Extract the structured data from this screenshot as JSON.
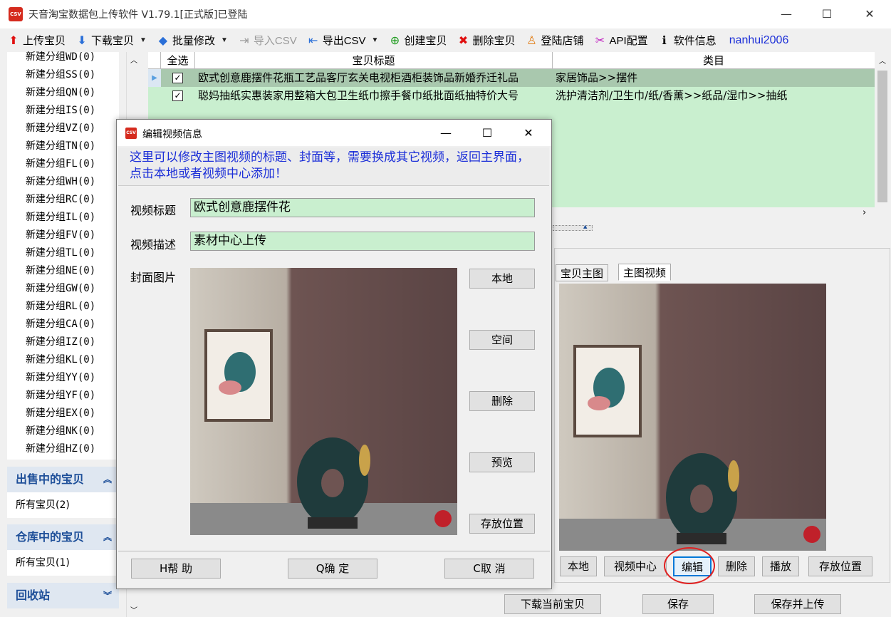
{
  "app": {
    "title": "天音淘宝数据包上传软件 V1.79.1[正式版]已登陆",
    "icon_text": "CSV",
    "minimize": "—",
    "maximize": "☐",
    "close": "✕"
  },
  "toolbar": {
    "upload": "上传宝贝",
    "download": "下载宝贝",
    "batch_edit": "批量修改",
    "import_csv": "导入CSV",
    "export_csv": "导出CSV",
    "create": "创建宝贝",
    "delete": "删除宝贝",
    "login_store": "登陆店铺",
    "api_config": "API配置",
    "software_info": "软件信息",
    "user": "nanhui2006"
  },
  "sidebar": {
    "groups": [
      "新建分组WD(0)",
      "新建分组SS(0)",
      "新建分组QN(0)",
      "新建分组IS(0)",
      "新建分组VZ(0)",
      "新建分组TN(0)",
      "新建分组FL(0)",
      "新建分组WH(0)",
      "新建分组RC(0)",
      "新建分组IL(0)",
      "新建分组FV(0)",
      "新建分组TL(0)",
      "新建分组NE(0)",
      "新建分组GW(0)",
      "新建分组RL(0)",
      "新建分组CA(0)",
      "新建分组IZ(0)",
      "新建分组KL(0)",
      "新建分组YY(0)",
      "新建分组YF(0)",
      "新建分组EX(0)",
      "新建分组NK(0)",
      "新建分组HZ(0)"
    ],
    "on_sale_title": "出售中的宝贝",
    "on_sale_item": "所有宝贝(2)",
    "warehouse_title": "仓库中的宝贝",
    "warehouse_item": "所有宝贝(1)",
    "recycle_title": "回收站"
  },
  "grid": {
    "headers": {
      "select_all": "全选",
      "title": "宝贝标题",
      "category": "类目"
    },
    "rows": [
      {
        "checked": "✓",
        "title": "欧式创意鹿摆件花瓶工艺品客厅玄关电视柜酒柜装饰品新婚乔迁礼品",
        "category": "家居饰品>>摆件"
      },
      {
        "checked": "✓",
        "title": "聪妈抽纸实惠装家用整箱大包卫生纸巾擦手餐巾纸批面纸抽特价大号",
        "category": "洗护清洁剂/卫生巾/纸/香薰>>纸品/湿巾>>抽纸"
      }
    ]
  },
  "right_panel": {
    "tab_main_image": "宝贝主图",
    "tab_main_video": "主图视频",
    "btn_local": "本地",
    "btn_video_center": "视频中心",
    "btn_edit": "编辑",
    "btn_delete": "删除",
    "btn_play": "播放",
    "btn_storage": "存放位置"
  },
  "bottom_bar": {
    "download_current": "下载当前宝贝",
    "save": "保存",
    "save_upload": "保存并上传"
  },
  "dialog": {
    "title": "编辑视频信息",
    "tip": "这里可以修改主图视频的标题、封面等，需要换成其它视频，返回主界面，点击本地或者视频中心添加！",
    "label_video_title": "视频标题",
    "video_title_value": "欧式创意鹿摆件花",
    "label_video_desc": "视频描述",
    "video_desc_value": "素材中心上传",
    "label_cover": "封面图片",
    "btn_local": "本地",
    "btn_space": "空间",
    "btn_delete": "删除",
    "btn_preview": "预览",
    "btn_storage": "存放位置",
    "btn_help": "H帮  助",
    "btn_ok": "Q确  定",
    "btn_cancel": "C取  消"
  },
  "colors": {
    "grid_bg": "#c9efcf",
    "section_header_bg": "#dfe7f1",
    "section_header_text": "#1e4f99",
    "tip_text": "#1c2fd8",
    "highlight_circle": "#e02020"
  }
}
